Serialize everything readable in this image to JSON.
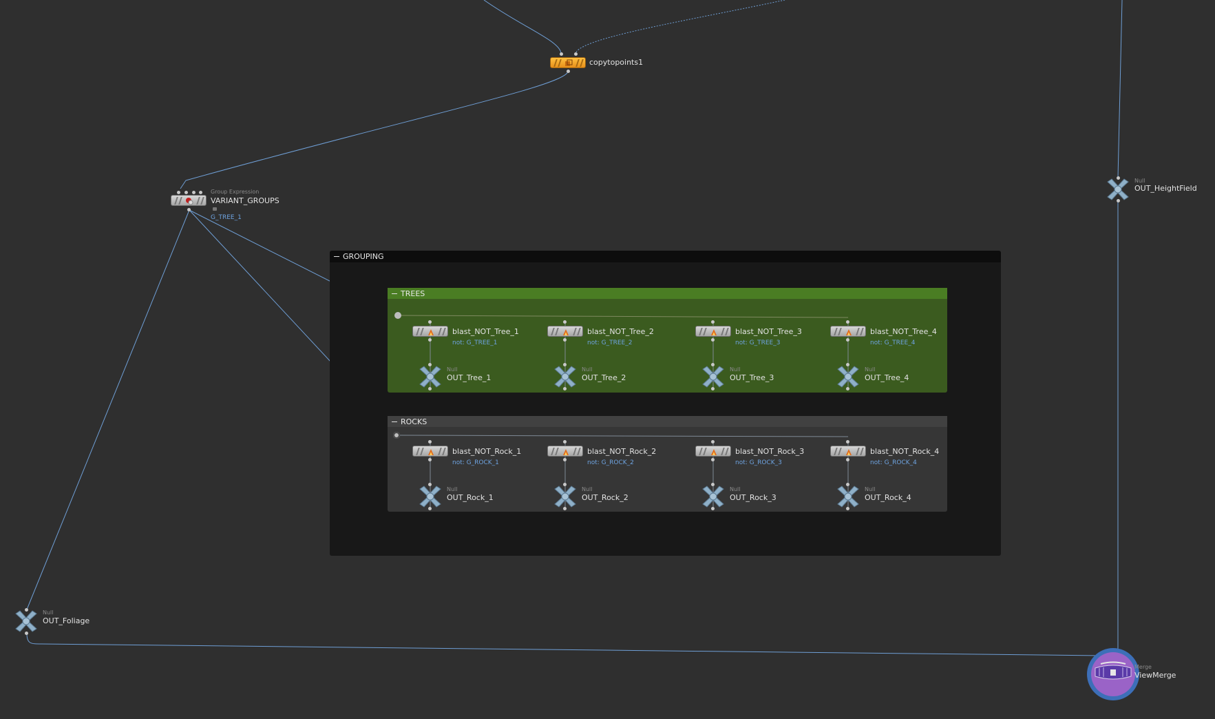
{
  "network": {
    "boxes": {
      "grouping": {
        "title": "GROUPING"
      },
      "trees": {
        "title": "TREES"
      },
      "rocks": {
        "title": "ROCKS"
      }
    },
    "nodes": {
      "copytopoints": {
        "name": "copytopoints1"
      },
      "variant_groups": {
        "type": "Group Expression",
        "name": "VARIANT_GROUPS",
        "comment": "G_TREE_1"
      },
      "out_heightfield": {
        "type": "Null",
        "name": "OUT_HeightField"
      },
      "out_foliage": {
        "type": "Null",
        "name": "OUT_Foliage"
      },
      "viewmerge": {
        "type": "Merge",
        "name": "ViewMerge"
      },
      "trees": {
        "blasts": [
          {
            "name": "blast_NOT_Tree_1",
            "comment": "not: G_TREE_1"
          },
          {
            "name": "blast_NOT_Tree_2",
            "comment": "not: G_TREE_2"
          },
          {
            "name": "blast_NOT_Tree_3",
            "comment": "not: G_TREE_3"
          },
          {
            "name": "blast_NOT_Tree_4",
            "comment": "not: G_TREE_4"
          }
        ],
        "outs": [
          {
            "type": "Null",
            "name": "OUT_Tree_1"
          },
          {
            "type": "Null",
            "name": "OUT_Tree_2"
          },
          {
            "type": "Null",
            "name": "OUT_Tree_3"
          },
          {
            "type": "Null",
            "name": "OUT_Tree_4"
          }
        ]
      },
      "rocks": {
        "blasts": [
          {
            "name": "blast_NOT_Rock_1",
            "comment": "not: G_ROCK_1"
          },
          {
            "name": "blast_NOT_Rock_2",
            "comment": "not: G_ROCK_2"
          },
          {
            "name": "blast_NOT_Rock_3",
            "comment": "not: G_ROCK_3"
          },
          {
            "name": "blast_NOT_Rock_4",
            "comment": "not: G_ROCK_4"
          }
        ],
        "outs": [
          {
            "type": "Null",
            "name": "OUT_Rock_1"
          },
          {
            "type": "Null",
            "name": "OUT_Rock_2"
          },
          {
            "type": "Null",
            "name": "OUT_Rock_3"
          },
          {
            "type": "Null",
            "name": "OUT_Rock_4"
          }
        ]
      }
    },
    "colors": {
      "background": "#2f2f2f",
      "wire": "#6f9fd6",
      "wire_dim": "#7f8a96",
      "trees_box": "#3b5b1f",
      "rocks_box": "#363636",
      "copytopoints": "#f0a020",
      "comment": "#6ea3e0"
    },
    "icons": {
      "blast": "blast-icon",
      "null": "null-icon",
      "merge": "merge-icon",
      "copy": "copy-icon",
      "group_expression": "group-expression-icon"
    }
  }
}
